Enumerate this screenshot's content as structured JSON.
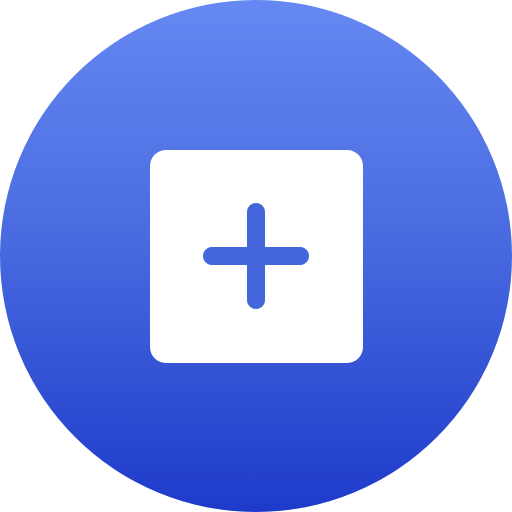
{
  "icon": {
    "name": "add-icon",
    "glyph": "plus",
    "colors": {
      "gradient_top": "#6688F2",
      "gradient_mid": "#4A6CE0",
      "gradient_bottom": "#1E3ACA",
      "square": "#FFFFFF",
      "plus": "#4565DA"
    }
  }
}
